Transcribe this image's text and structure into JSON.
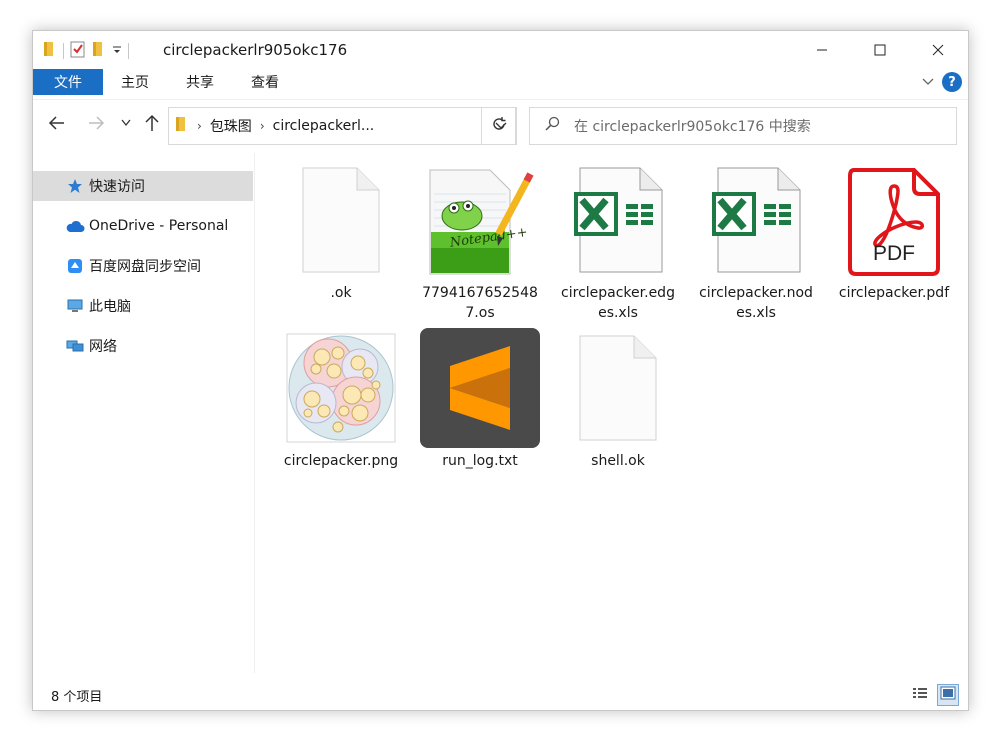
{
  "window": {
    "title": "circlepackerlr905okc176"
  },
  "ribbon": {
    "tabs": [
      {
        "label": "文件",
        "active": true
      },
      {
        "label": "主页"
      },
      {
        "label": "共享"
      },
      {
        "label": "查看"
      }
    ],
    "help_label": "?"
  },
  "address": {
    "segments": [
      "包珠图",
      "circlepackerl..."
    ]
  },
  "search": {
    "placeholder": "在 circlepackerlr905okc176 中搜索"
  },
  "nav": {
    "items": [
      {
        "label": "快速访问",
        "icon": "star-icon",
        "selected": true
      },
      {
        "label": "OneDrive - Personal",
        "icon": "cloud-icon"
      },
      {
        "label": "百度网盘同步空间",
        "icon": "baidu-netdisk-icon"
      },
      {
        "label": "此电脑",
        "icon": "computer-icon"
      },
      {
        "label": "网络",
        "icon": "network-icon"
      }
    ]
  },
  "files": [
    {
      "name": ".ok",
      "icon": "blank-file-icon"
    },
    {
      "name": "77941676525487.os",
      "icon": "notepad-plus-plus-icon",
      "logo_text": "Notepad++"
    },
    {
      "name": "circlepacker.edges.xls",
      "icon": "excel-file-icon"
    },
    {
      "name": "circlepacker.nodes.xls",
      "icon": "excel-file-icon"
    },
    {
      "name": "circlepacker.pdf",
      "icon": "pdf-file-icon",
      "badge": "PDF"
    },
    {
      "name": "circlepacker.png",
      "icon": "circle-packing-thumbnail"
    },
    {
      "name": "run_log.txt",
      "icon": "sublime-text-icon"
    },
    {
      "name": "shell.ok",
      "icon": "blank-file-icon"
    }
  ],
  "status": {
    "item_count": "8 个项目"
  },
  "colors": {
    "accent": "#1a6fc4",
    "excel_green": "#1d7a45",
    "pdf_red": "#e0161b",
    "sublime_orange": "#ff9800",
    "sublime_bg": "#4a4a4a"
  }
}
